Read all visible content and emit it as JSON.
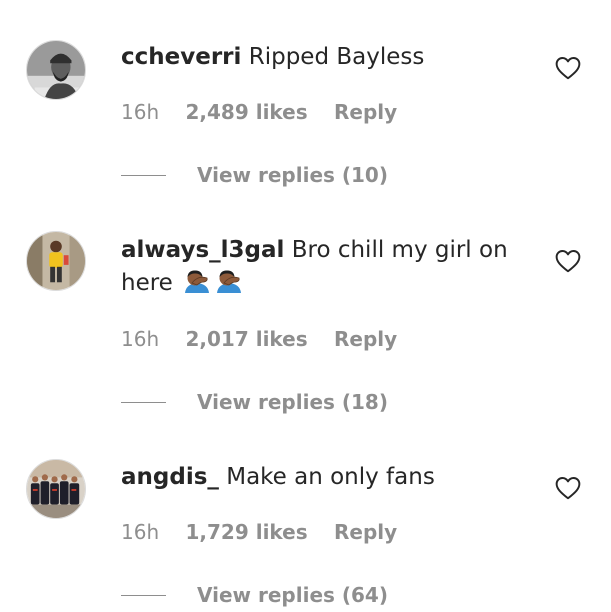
{
  "comments": [
    {
      "username": "ccheverri",
      "text": "Ripped Bayless",
      "time": "16h",
      "likes": "2,489 likes",
      "reply_label": "Reply",
      "view_replies": "View replies (10)",
      "avatar": "man-in-beanie-avatar-icon"
    },
    {
      "username": "always_l3gal",
      "text": "Bro chill my girl on here",
      "emoji": [
        "face-palm-emoji",
        "face-palm-emoji"
      ],
      "time": "16h",
      "likes": "2,017 likes",
      "reply_label": "Reply",
      "view_replies": "View replies (18)",
      "avatar": "person-yellow-shirt-avatar-icon"
    },
    {
      "username": "angdis_",
      "text": "Make an only fans",
      "time": "16h",
      "likes": "1,729 likes",
      "reply_label": "Reply",
      "view_replies": "View replies (64)",
      "avatar": "team-group-photo-avatar-icon"
    }
  ],
  "colors": {
    "text": "#262626",
    "secondary": "#8e8e8e",
    "background": "#ffffff"
  }
}
